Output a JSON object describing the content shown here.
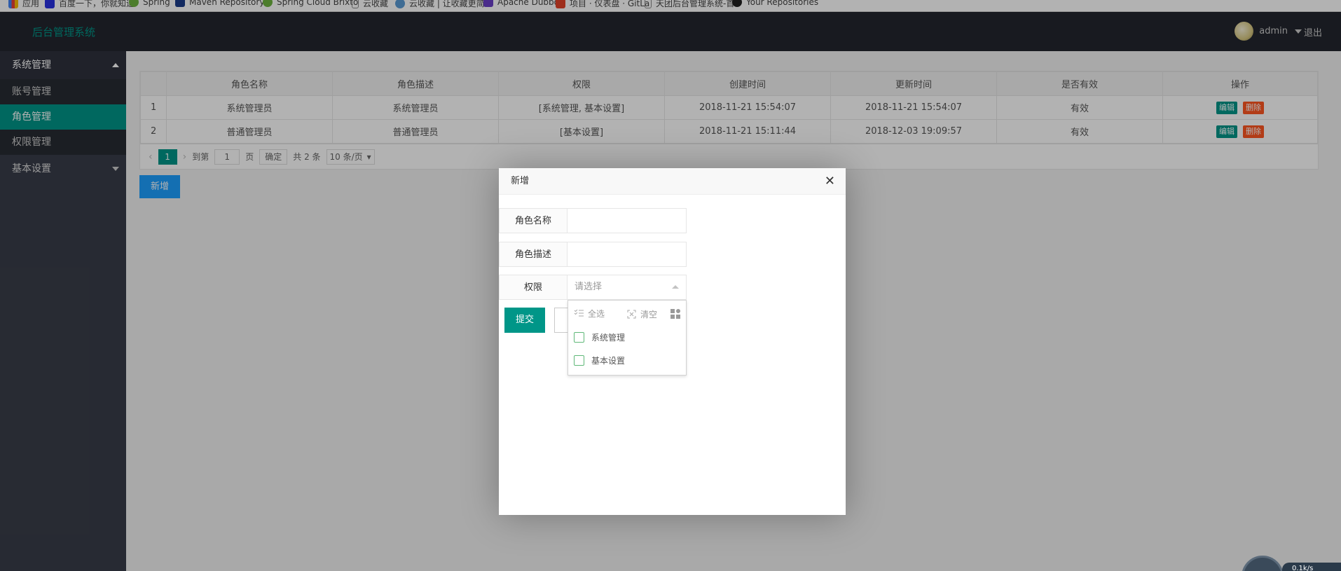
{
  "bookmarks": [
    {
      "label": "应用",
      "icon": "apps-grid-icon"
    },
    {
      "label": "百度一下，你就知道",
      "icon": "baidu-paw-icon"
    },
    {
      "label": "Spring",
      "icon": "spring-leaf-icon"
    },
    {
      "label": "Maven Repository:",
      "icon": "maven-icon"
    },
    {
      "label": "Spring Cloud Brixto",
      "icon": "spring-leaf-icon"
    },
    {
      "label": "云收藏",
      "icon": "page-icon"
    },
    {
      "label": "云收藏 | 让收藏更简",
      "icon": "cloud-icon"
    },
    {
      "label": "Apache Dubbo",
      "icon": "dubbo-icon"
    },
    {
      "label": "项目 · 仪表盘 · GitLa",
      "icon": "gitlab-fox-icon"
    },
    {
      "label": "天团后台管理系统-首",
      "icon": "page-icon"
    },
    {
      "label": "Your Repositories",
      "icon": "github-icon"
    }
  ],
  "header": {
    "logo": "后台管理系统",
    "username": "admin",
    "logout": "退出"
  },
  "sidebar": {
    "groups": [
      {
        "label": "系统管理",
        "expanded": true,
        "items": [
          {
            "label": "账号管理",
            "active": false
          },
          {
            "label": "角色管理",
            "active": true
          },
          {
            "label": "权限管理",
            "active": false
          }
        ]
      },
      {
        "label": "基本设置",
        "expanded": false,
        "items": []
      }
    ]
  },
  "table": {
    "columns": [
      "",
      "角色名称",
      "角色描述",
      "权限",
      "创建时间",
      "更新时间",
      "是否有效",
      "操作"
    ],
    "rows": [
      {
        "num": "1",
        "name": "系统管理员",
        "desc": "系统管理员",
        "perm": "[系统管理, 基本设置]",
        "created": "2018-11-21 15:54:07",
        "updated": "2018-11-21 15:54:07",
        "valid": "有效"
      },
      {
        "num": "2",
        "name": "普通管理员",
        "desc": "普通管理员",
        "perm": "[基本设置]",
        "created": "2018-11-21 15:11:44",
        "updated": "2018-12-03 19:09:57",
        "valid": "有效"
      }
    ],
    "edit_label": "编辑",
    "delete_label": "删除"
  },
  "pager": {
    "prev": "‹",
    "current": "1",
    "next": "›",
    "goto_label": "到第",
    "goto_value": "1",
    "page_label": "页",
    "confirm": "确定",
    "total": "共 2 条",
    "page_size": "10 条/页"
  },
  "add_button": "新增",
  "dialog": {
    "title": "新增",
    "close": "✕",
    "fields": {
      "name_label": "角色名称",
      "name_value": "",
      "desc_label": "角色描述",
      "desc_value": "",
      "perm_label": "权限",
      "perm_placeholder": "请选择"
    },
    "submit": "提交",
    "dropdown": {
      "select_all": "全选",
      "clear": "清空",
      "options": [
        "系统管理",
        "基本设置"
      ]
    }
  },
  "widget": {
    "text": "0.1k/s"
  },
  "colors": {
    "primary": "#009688",
    "danger": "#ff5722",
    "blue": "#1e9fff",
    "header": "#23262e",
    "sidebar": "#393d49"
  }
}
